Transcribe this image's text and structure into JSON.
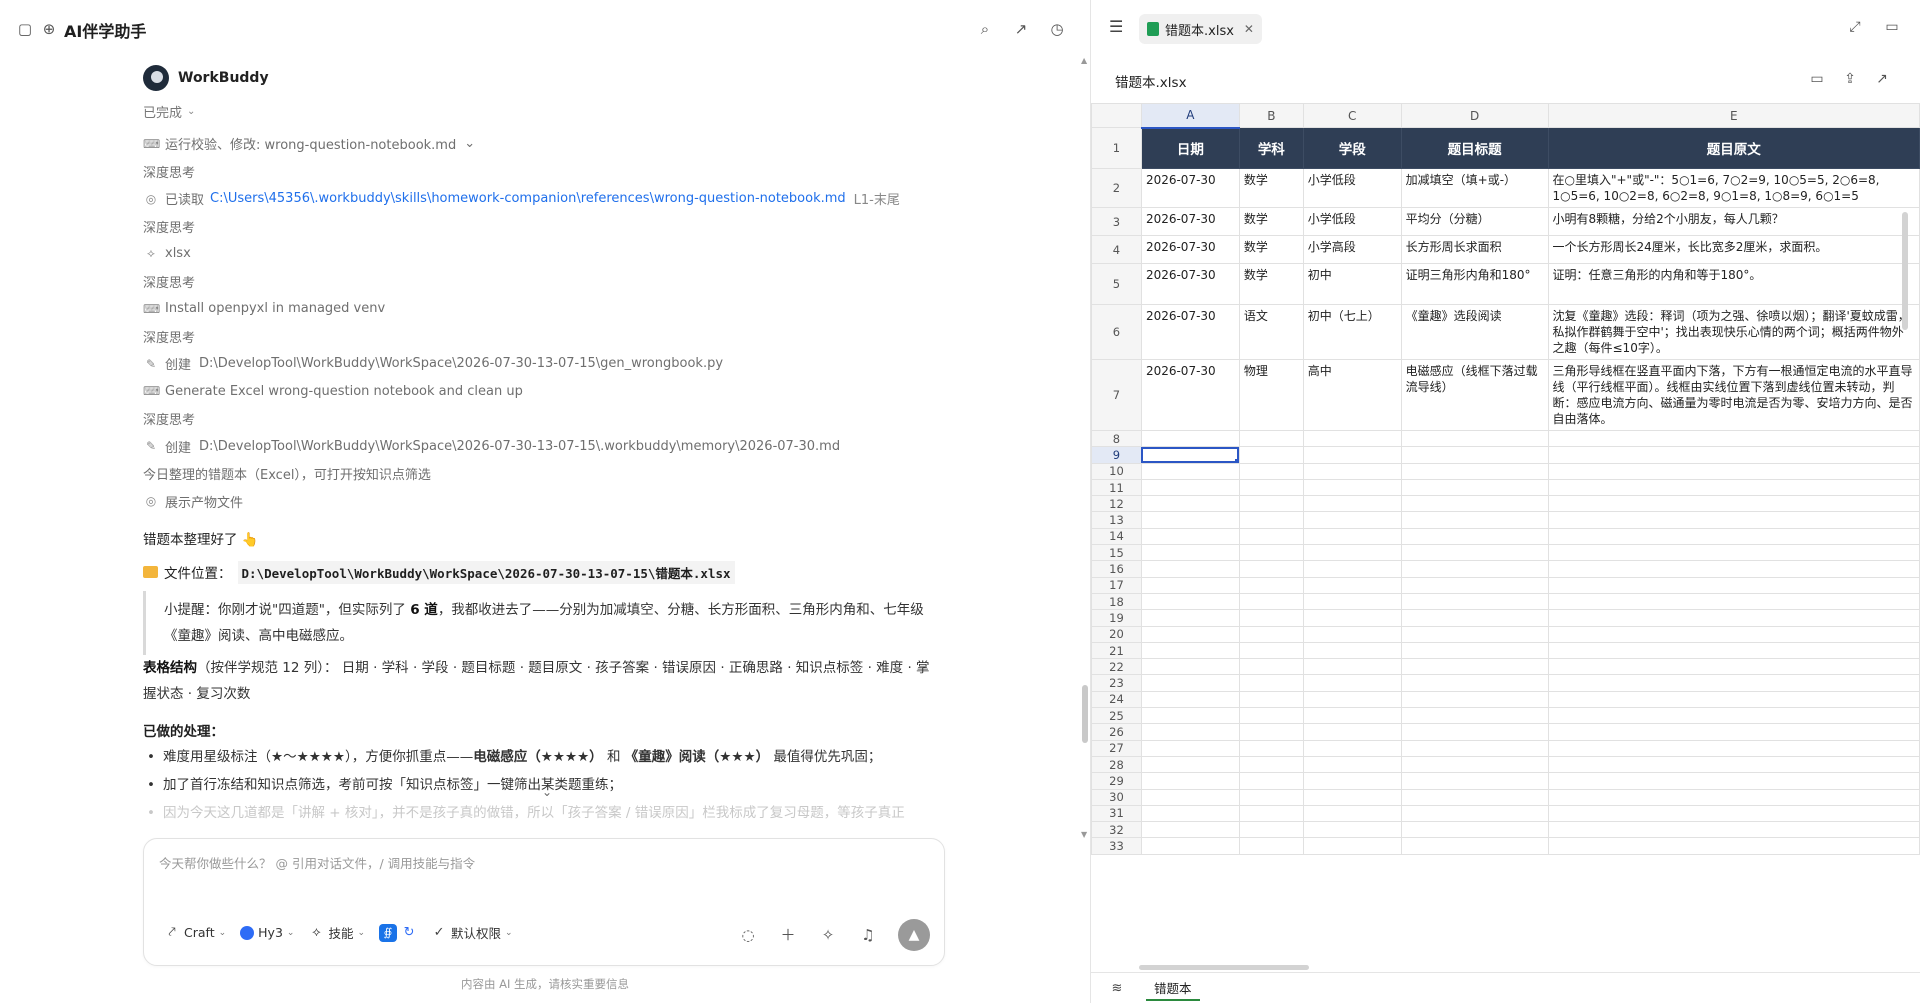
{
  "app": {
    "title": "AI伴学助手"
  },
  "chat": {
    "bot_name": "WorkBuddy",
    "status": "已完成",
    "steps": [
      {
        "icon": "terminal-icon",
        "text": "运行校验、修改: wrong-question-notebook.md",
        "path": "",
        "suffix": "",
        "chevron": "⌄"
      },
      {
        "icon": "",
        "text": "深度思考",
        "path": "",
        "suffix": "",
        "chevron": ""
      },
      {
        "icon": "eye-icon",
        "text": "已读取",
        "path": "C:\\Users\\45356\\.workbuddy\\skills\\homework-companion\\references\\wrong-question-notebook.md",
        "suffix": "L1-末尾",
        "chevron": ""
      },
      {
        "icon": "",
        "text": "深度思考",
        "path": "",
        "suffix": "",
        "chevron": ""
      },
      {
        "icon": "skill-icon",
        "text": "xlsx",
        "path": "",
        "suffix": "",
        "chevron": ""
      },
      {
        "icon": "",
        "text": "深度思考",
        "path": "",
        "suffix": "",
        "chevron": ""
      },
      {
        "icon": "terminal-icon",
        "text": "Install openpyxl in managed venv",
        "path": "",
        "suffix": "",
        "chevron": ""
      },
      {
        "icon": "",
        "text": "深度思考",
        "path": "",
        "suffix": "",
        "chevron": ""
      },
      {
        "icon": "pencil-icon",
        "text": "创建",
        "path": "",
        "suffix": "D:\\DevelopTool\\WorkBuddy\\WorkSpace\\2026-07-30-13-07-15\\gen_wrongbook.py",
        "chevron": ""
      },
      {
        "icon": "terminal-icon",
        "text": "Generate Excel wrong-question notebook and clean up",
        "path": "",
        "suffix": "",
        "chevron": ""
      },
      {
        "icon": "",
        "text": "深度思考",
        "path": "",
        "suffix": "",
        "chevron": ""
      },
      {
        "icon": "pencil-icon",
        "text": "创建",
        "path": "",
        "suffix": "D:\\DevelopTool\\WorkBuddy\\WorkSpace\\2026-07-30-13-07-15\\.workbuddy\\memory\\2026-07-30.md",
        "chevron": ""
      },
      {
        "icon": "",
        "text": "今日整理的错题本（Excel），可打开按知识点筛选",
        "path": "",
        "suffix": "",
        "chevron": ""
      },
      {
        "icon": "eye-icon",
        "text": "展示产物文件",
        "path": "",
        "suffix": "",
        "chevron": ""
      }
    ],
    "reply": {
      "ready": "错题本整理好了 👆",
      "file_label": "文件位置：",
      "file_path": "D:\\DevelopTool\\WorkBuddy\\WorkSpace\\2026-07-30-13-07-15\\错题本.xlsx",
      "quote_pre": "小提醒：你刚才说\"四道题\"，但实际列了 ",
      "quote_bold": "6 道",
      "quote_post": "，我都收进去了——分别为加减填空、分糖、长方形面积、三角形内角和、七年级《童趣》阅读、高中电磁感应。",
      "struct_bold": "表格结构",
      "struct_text": "（按伴学规范 12 列）： 日期 · 学科 · 学段 · 题目标题 · 题目原文 · 孩子答案 · 错误原因 · 正确思路 · 知识点标签 · 难度 · 掌握状态 · 复习次数",
      "done_heading": "已做的处理：",
      "bullet1_pre": "难度用星级标注（★～★★★★），方便你抓重点——",
      "bullet1_b1": "电磁感应（★★★★）",
      "bullet1_mid": " 和 ",
      "bullet1_b2": "《童趣》阅读（★★★）",
      "bullet1_post": " 最值得优先巩固；",
      "bullet2": "加了首行冻结和知识点筛选，考前可按「知识点标签」一键筛出某类题重练；",
      "bullet3": "因为今天这几道都是「讲解 + 核对」，并不是孩子真的做错，所以「孩子答案 / 错误原因」栏我标成了复习母题，等孩子真正"
    },
    "input": {
      "placeholder": "今天帮你做些什么？ @ 引用对话文件，/ 调用技能与指令",
      "tools": {
        "craft": "Craft",
        "model": "Hy3",
        "skills": "技能",
        "permission": "默认权限"
      }
    },
    "footnote": "内容由 AI 生成，请核实重要信息"
  },
  "viewer": {
    "tab_name": "错题本.xlsx",
    "file_title": "错题本.xlsx",
    "sheet_tab": "错题本",
    "columns": [
      "A",
      "B",
      "C",
      "D",
      "E"
    ],
    "header_row": [
      "日期",
      "学科",
      "学段",
      "题目标题",
      "题目原文"
    ],
    "rows": [
      [
        "2026-07-30",
        "数学",
        "小学低段",
        "加减填空（填+或-）",
        "在○里填入\"+\"或\"-\"：5○1=6, 7○2=9, 10○5=5, 2○6=8, 1○5=6, 10○2=8, 6○2=8, 9○1=8, 1○8=9, 6○1=5"
      ],
      [
        "2026-07-30",
        "数学",
        "小学低段",
        "平均分（分糖）",
        "小明有8颗糖，分给2个小朋友，每人几颗？"
      ],
      [
        "2026-07-30",
        "数学",
        "小学高段",
        "长方形周长求面积",
        "一个长方形周长24厘米，长比宽多2厘米，求面积。"
      ],
      [
        "2026-07-30",
        "数学",
        "初中",
        "证明三角形内角和180°",
        "证明：任意三角形的内角和等于180°。"
      ],
      [
        "2026-07-30",
        "语文",
        "初中（七上）",
        "《童趣》选段阅读",
        "沈复《童趣》选段：释词（项为之强、徐喷以烟）；翻译'夏蚊成雷，私拟作群鹤舞于空中'；找出表现快乐心情的两个词；概括两件物外之趣（每件≤10字）。"
      ],
      [
        "2026-07-30",
        "物理",
        "高中",
        "电磁感应（线框下落过载流导线）",
        "三角形导线框在竖直平面内下落，下方有一根通恒定电流的水平直导线（平行线框平面）。线框由实线位置下落到虚线位置未转动，判断：感应电流方向、磁通量为零时电流是否为零、安培力方向、是否自由落体。"
      ]
    ],
    "row_numbers": [
      "1",
      "2",
      "3",
      "4",
      "5",
      "6",
      "7",
      "8",
      "9",
      "10",
      "11",
      "12",
      "13",
      "14",
      "15",
      "16",
      "17",
      "18",
      "19",
      "20",
      "21",
      "22",
      "23",
      "24",
      "25",
      "26",
      "27",
      "28",
      "29",
      "30",
      "31",
      "32",
      "33"
    ],
    "selected_cell": "A9"
  },
  "colors": {
    "link": "#1f6feb",
    "header_fill": "#2f3e55",
    "selection": "#2b56c5",
    "excel_green": "#1f9d55"
  }
}
